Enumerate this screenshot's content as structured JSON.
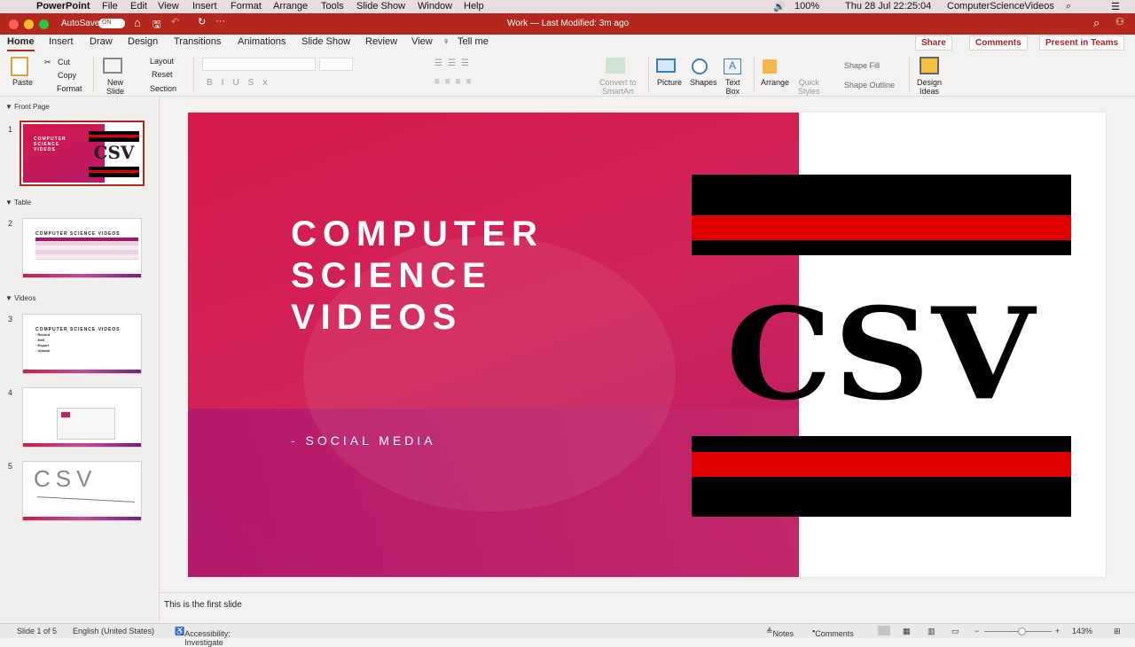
{
  "menubar": {
    "app": "PowerPoint",
    "items": [
      "File",
      "Edit",
      "View",
      "Insert",
      "Format",
      "Arrange",
      "Tools",
      "Slide Show",
      "Window",
      "Help"
    ],
    "battery": "100%",
    "datetime": "Thu 28 Jul  22:25:04",
    "user": "ComputerScienceVideos"
  },
  "titlebar": {
    "autosave": "AutoSave",
    "toggle": "ON",
    "doc": "Work — Last Modified: 3m ago"
  },
  "tabs": [
    "Home",
    "Insert",
    "Draw",
    "Design",
    "Transitions",
    "Animations",
    "Slide Show",
    "Review",
    "View"
  ],
  "tell_me": "Tell me",
  "actions": {
    "share": "Share",
    "comments": "Comments",
    "teams": "Present in Teams"
  },
  "ribbon": {
    "paste": "Paste",
    "cut": "Cut",
    "copy": "Copy",
    "format": "Format",
    "new_slide": [
      "New",
      "Slide"
    ],
    "layout": "Layout",
    "reset": "Reset",
    "section": "Section",
    "convert": [
      "Convert to",
      "SmartArt"
    ],
    "picture": "Picture",
    "shapes": "Shapes",
    "textbox": [
      "Text",
      "Box"
    ],
    "arrange": "Arrange",
    "quick": [
      "Quick",
      "Styles"
    ],
    "fill": "Shape Fill",
    "outline": "Shape Outline",
    "design": [
      "Design",
      "Ideas"
    ]
  },
  "panel": {
    "sections": [
      "Front Page",
      "Table",
      "Videos"
    ],
    "numbers": [
      "1",
      "2",
      "3",
      "4",
      "5"
    ],
    "thumb_title": "COMPUTER SCIENCE VIDEOS",
    "thumb3_bullets": [
      "· Record",
      "· Edit",
      "· Export",
      "· Upload"
    ],
    "thumb5_text": "CSV"
  },
  "slide": {
    "title_lines": [
      "COMPUTER",
      "SCIENCE",
      "VIDEOS"
    ],
    "subtitle": "- SOCIAL MEDIA",
    "logo": "CSV",
    "colors": {
      "crimson": "#d6184a",
      "magenta": "#b0186e",
      "red": "#e00000"
    }
  },
  "notes": "This is the first slide",
  "status": {
    "slide": "Slide 1 of 5",
    "lang": "English (United States)",
    "access": "Accessibility: Investigate",
    "notes": "Notes",
    "comments": "Comments",
    "zoom": "143%",
    "zoom_fraction": 0.55
  }
}
